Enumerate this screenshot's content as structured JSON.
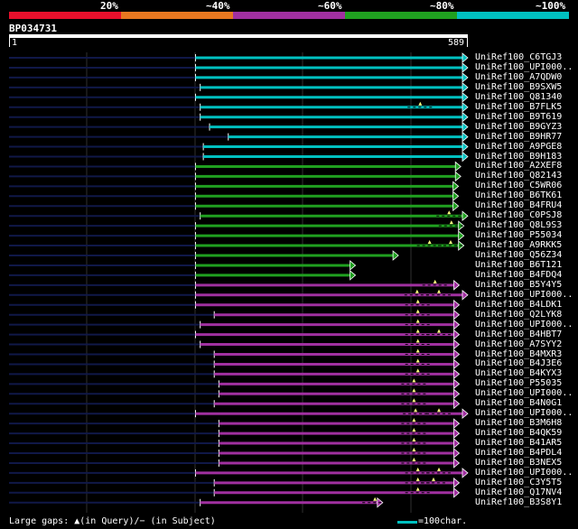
{
  "legend": {
    "segments": [
      {
        "label": "20%",
        "color": "#e8102c"
      },
      {
        "label": "~40%",
        "color": "#e87820"
      },
      {
        "label": "~60%",
        "color": "#a030a0"
      },
      {
        "label": "~80%",
        "color": "#20a020"
      },
      {
        "label": "~100%",
        "color": "#00c0c0"
      }
    ]
  },
  "query": {
    "name": "BP034731",
    "start_label": "1",
    "end_label": "589",
    "length": 589
  },
  "chart_data": {
    "type": "alignment",
    "query_length": 589,
    "hits": [
      {
        "name": "UniRef100_C6TGJ3",
        "start": 240,
        "end": 589,
        "identity": "~100%"
      },
      {
        "name": "UniRef100_UPI000..",
        "start": 240,
        "end": 589,
        "identity": "~100%"
      },
      {
        "name": "UniRef100_A7QDW0",
        "start": 240,
        "end": 589,
        "identity": "~100%"
      },
      {
        "name": "UniRef100_B9SXW5",
        "start": 246,
        "end": 589,
        "identity": "~100%"
      },
      {
        "name": "UniRef100_Q81340",
        "start": 240,
        "end": 589,
        "identity": "~100%"
      },
      {
        "name": "UniRef100_B7FLK5",
        "start": 246,
        "end": 589,
        "identity": "~100%",
        "gaps": [
          528
        ]
      },
      {
        "name": "UniRef100_B9T619",
        "start": 246,
        "end": 589,
        "identity": "~100%"
      },
      {
        "name": "UniRef100_B9GYZ3",
        "start": 258,
        "end": 589,
        "identity": "~100%"
      },
      {
        "name": "UniRef100_B9HR77",
        "start": 282,
        "end": 589,
        "identity": "~100%"
      },
      {
        "name": "UniRef100_A9PGE8",
        "start": 250,
        "end": 589,
        "identity": "~100%"
      },
      {
        "name": "UniRef100_B9H183",
        "start": 250,
        "end": 589,
        "identity": "~100%"
      },
      {
        "name": "UniRef100_A2XEF8",
        "start": 240,
        "end": 580,
        "identity": "~80%"
      },
      {
        "name": "UniRef100_Q82143",
        "start": 240,
        "end": 580,
        "identity": "~80%"
      },
      {
        "name": "UniRef100_C5WR06",
        "start": 240,
        "end": 577,
        "identity": "~80%"
      },
      {
        "name": "UniRef100_B6TK61",
        "start": 240,
        "end": 577,
        "identity": "~80%"
      },
      {
        "name": "UniRef100_B4FRU4",
        "start": 240,
        "end": 577,
        "identity": "~80%"
      },
      {
        "name": "UniRef100_C0PSJ8",
        "start": 246,
        "end": 589,
        "identity": "~80%",
        "gaps": [
          565
        ]
      },
      {
        "name": "UniRef100_Q8L9S3",
        "start": 240,
        "end": 584,
        "identity": "~80%",
        "gaps": [
          568
        ]
      },
      {
        "name": "UniRef100_P55034",
        "start": 240,
        "end": 584,
        "identity": "~80%"
      },
      {
        "name": "UniRef100_A9RKK5",
        "start": 240,
        "end": 584,
        "identity": "~80%",
        "gaps": [
          540,
          567
        ]
      },
      {
        "name": "UniRef100_Q56Z34",
        "start": 240,
        "end": 500,
        "identity": "~80%"
      },
      {
        "name": "UniRef100_B6T121",
        "start": 240,
        "end": 445,
        "identity": "~80%"
      },
      {
        "name": "UniRef100_B4FDQ4",
        "start": 240,
        "end": 445,
        "identity": "~80%"
      },
      {
        "name": "UniRef100_B5Y4Y5",
        "start": 240,
        "end": 578,
        "identity": "~60%",
        "gaps": [
          547
        ]
      },
      {
        "name": "UniRef100_UPI000..",
        "start": 240,
        "end": 589,
        "identity": "~60%",
        "gaps": [
          524,
          552
        ]
      },
      {
        "name": "UniRef100_B4LDK1",
        "start": 240,
        "end": 578,
        "identity": "~60%",
        "gaps": [
          525
        ]
      },
      {
        "name": "UniRef100_Q2LYK8",
        "start": 264,
        "end": 578,
        "identity": "~60%",
        "gaps": [
          525
        ]
      },
      {
        "name": "UniRef100_UPI000..",
        "start": 246,
        "end": 578,
        "identity": "~60%",
        "gaps": [
          525
        ]
      },
      {
        "name": "UniRef100_B4HBT7",
        "start": 240,
        "end": 578,
        "identity": "~60%",
        "gaps": [
          525,
          552
        ]
      },
      {
        "name": "UniRef100_A7SYY2",
        "start": 246,
        "end": 578,
        "identity": "~60%",
        "gaps": [
          525
        ]
      },
      {
        "name": "UniRef100_B4MXR3",
        "start": 264,
        "end": 578,
        "identity": "~60%",
        "gaps": [
          525
        ]
      },
      {
        "name": "UniRef100_B4J3E6",
        "start": 264,
        "end": 578,
        "identity": "~60%",
        "gaps": [
          525
        ]
      },
      {
        "name": "UniRef100_B4KYX3",
        "start": 264,
        "end": 578,
        "identity": "~60%",
        "gaps": [
          525
        ]
      },
      {
        "name": "UniRef100_P55035",
        "start": 270,
        "end": 578,
        "identity": "~60%",
        "gaps": [
          520
        ]
      },
      {
        "name": "UniRef100_UPI000..",
        "start": 270,
        "end": 578,
        "identity": "~60%",
        "gaps": [
          520
        ]
      },
      {
        "name": "UniRef100_B4N0G1",
        "start": 264,
        "end": 578,
        "identity": "~60%",
        "gaps": [
          520
        ]
      },
      {
        "name": "UniRef100_UPI000..",
        "start": 240,
        "end": 589,
        "identity": "~60%",
        "gaps": [
          522,
          552
        ]
      },
      {
        "name": "UniRef100_B3M6H8",
        "start": 270,
        "end": 578,
        "identity": "~60%",
        "gaps": [
          520
        ]
      },
      {
        "name": "UniRef100_B4QK59",
        "start": 270,
        "end": 578,
        "identity": "~60%",
        "gaps": [
          520
        ]
      },
      {
        "name": "UniRef100_B41AR5",
        "start": 270,
        "end": 578,
        "identity": "~60%",
        "gaps": [
          520
        ]
      },
      {
        "name": "UniRef100_B4PDL4",
        "start": 270,
        "end": 578,
        "identity": "~60%",
        "gaps": [
          520
        ]
      },
      {
        "name": "UniRef100_B3NEX5",
        "start": 270,
        "end": 578,
        "identity": "~60%",
        "gaps": [
          520
        ]
      },
      {
        "name": "UniRef100_UPI000..",
        "start": 240,
        "end": 589,
        "identity": "~60%",
        "gaps": [
          525,
          552
        ]
      },
      {
        "name": "UniRef100_C3Y5T5",
        "start": 264,
        "end": 578,
        "identity": "~60%",
        "gaps": [
          525,
          545
        ]
      },
      {
        "name": "UniRef100_Q17NV4",
        "start": 264,
        "end": 578,
        "identity": "~60%",
        "gaps": [
          525
        ]
      },
      {
        "name": "UniRef100_B3S8Y1",
        "start": 246,
        "end": 480,
        "identity": "~60%",
        "gaps": [
          470
        ]
      }
    ]
  },
  "footer": {
    "legend_text": "Large gaps: ▲(in Query)/− (in Subject)",
    "scale_text": "=100char."
  }
}
